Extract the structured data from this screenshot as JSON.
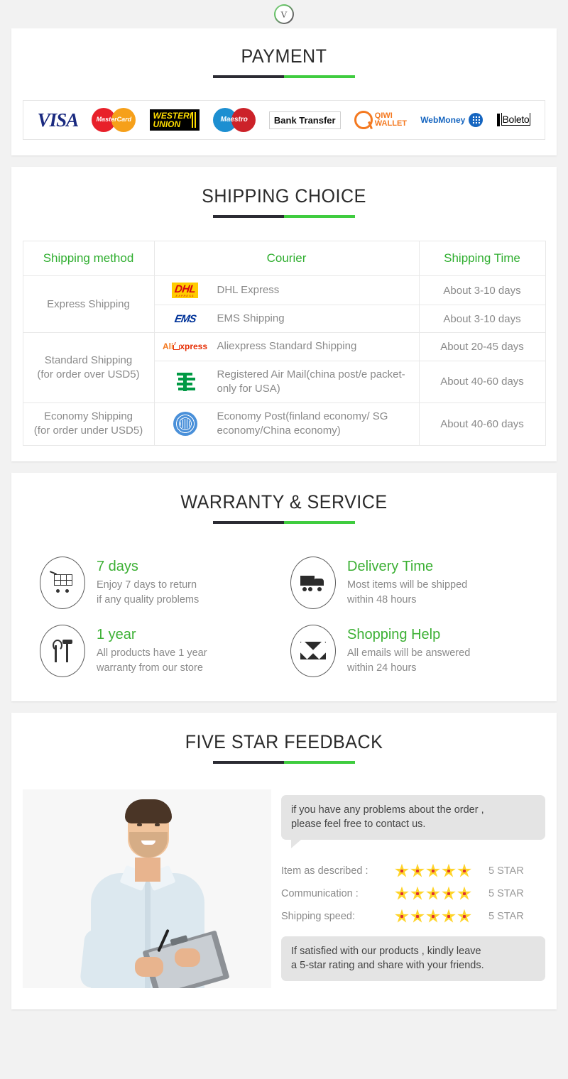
{
  "top_badge": {
    "icon": "chevron-down-circle-icon",
    "glyph": "V"
  },
  "sections": {
    "payment": {
      "title": "PAYMENT",
      "logos": [
        {
          "name": "visa-logo",
          "label": "VISA"
        },
        {
          "name": "mastercard-logo",
          "label": "MasterCard"
        },
        {
          "name": "western-union-logo",
          "line1": "WESTERN",
          "line2": "UNION"
        },
        {
          "name": "maestro-logo",
          "label": "Maestro"
        },
        {
          "name": "bank-transfer-logo",
          "label": "Bank Transfer"
        },
        {
          "name": "qiwi-wallet-logo",
          "line1": "QIWI",
          "line2": "WALLET"
        },
        {
          "name": "webmoney-logo",
          "label": "WebMoney"
        },
        {
          "name": "boleto-logo",
          "label": "Boleto"
        }
      ]
    },
    "shipping": {
      "title": "SHIPPING CHOICE",
      "columns": [
        "Shipping method",
        "Courier",
        "Shipping Time"
      ],
      "rows": [
        {
          "method": "Express Shipping",
          "method_sub": "",
          "rowspan": 2,
          "couriers": [
            {
              "logo": "dhl-logo",
              "name": "DHL Express",
              "time": "About 3-10 days"
            },
            {
              "logo": "ems-logo",
              "name": "EMS Shipping",
              "time": "About 3-10 days"
            }
          ]
        },
        {
          "method": "Standard Shipping",
          "method_sub": "(for order over USD5)",
          "rowspan": 2,
          "couriers": [
            {
              "logo": "aliexpress-logo",
              "name": "Aliexpress Standard Shipping",
              "time": "About 20-45 days"
            },
            {
              "logo": "china-post-logo",
              "name": "Registered Air Mail(china post/e packet-only for USA)",
              "time": "About 40-60 days"
            }
          ]
        },
        {
          "method": "Economy Shipping",
          "method_sub": "(for order under USD5)",
          "rowspan": 1,
          "couriers": [
            {
              "logo": "un-globe-logo",
              "name": "Economy Post(finland economy/ SG economy/China economy)",
              "time": "About 40-60 days"
            }
          ]
        }
      ]
    },
    "warranty": {
      "title": "WARRANTY & SERVICE",
      "items": [
        {
          "icon": "shopping-cart-icon",
          "heading": "7 days",
          "line1": "Enjoy 7 days to return",
          "line2": "if any quality problems"
        },
        {
          "icon": "delivery-truck-icon",
          "heading": "Delivery Time",
          "line1": "Most items will be shipped",
          "line2": "within 48 hours"
        },
        {
          "icon": "tools-icon",
          "heading": "1 year",
          "line1": "All products have 1 year",
          "line2": "warranty from our store"
        },
        {
          "icon": "envelope-icon",
          "heading": "Shopping Help",
          "line1": "All emails will be answered",
          "line2": "within 24 hours"
        }
      ]
    },
    "feedback": {
      "title": "FIVE STAR FEEDBACK",
      "photo_alt": "smiling-man-with-clipboard-photo",
      "bubble_top_line1": "if you have any problems about the order ,",
      "bubble_top_line2": "please feel free to contact us.",
      "ratings": [
        {
          "label": "Item as described :",
          "stars": 5,
          "value": "5 STAR"
        },
        {
          "label": "Communication :",
          "stars": 5,
          "value": "5 STAR"
        },
        {
          "label": "Shipping speed:",
          "stars": 5,
          "value": "5 STAR"
        }
      ],
      "bubble_bottom_line1": "If satisfied with our products ,  kindly leave",
      "bubble_bottom_line2": "a 5-star rating and share with your friends."
    }
  },
  "colors": {
    "green": "#3cb034",
    "header_green": "#2fae2f",
    "dark": "#2b2b33",
    "divider_green": "#3fcc3f",
    "body_text": "#8a8a8a",
    "page_bg": "#f2f2f2",
    "bubble_bg": "#e4e4e4",
    "star": "#ffd42a"
  }
}
